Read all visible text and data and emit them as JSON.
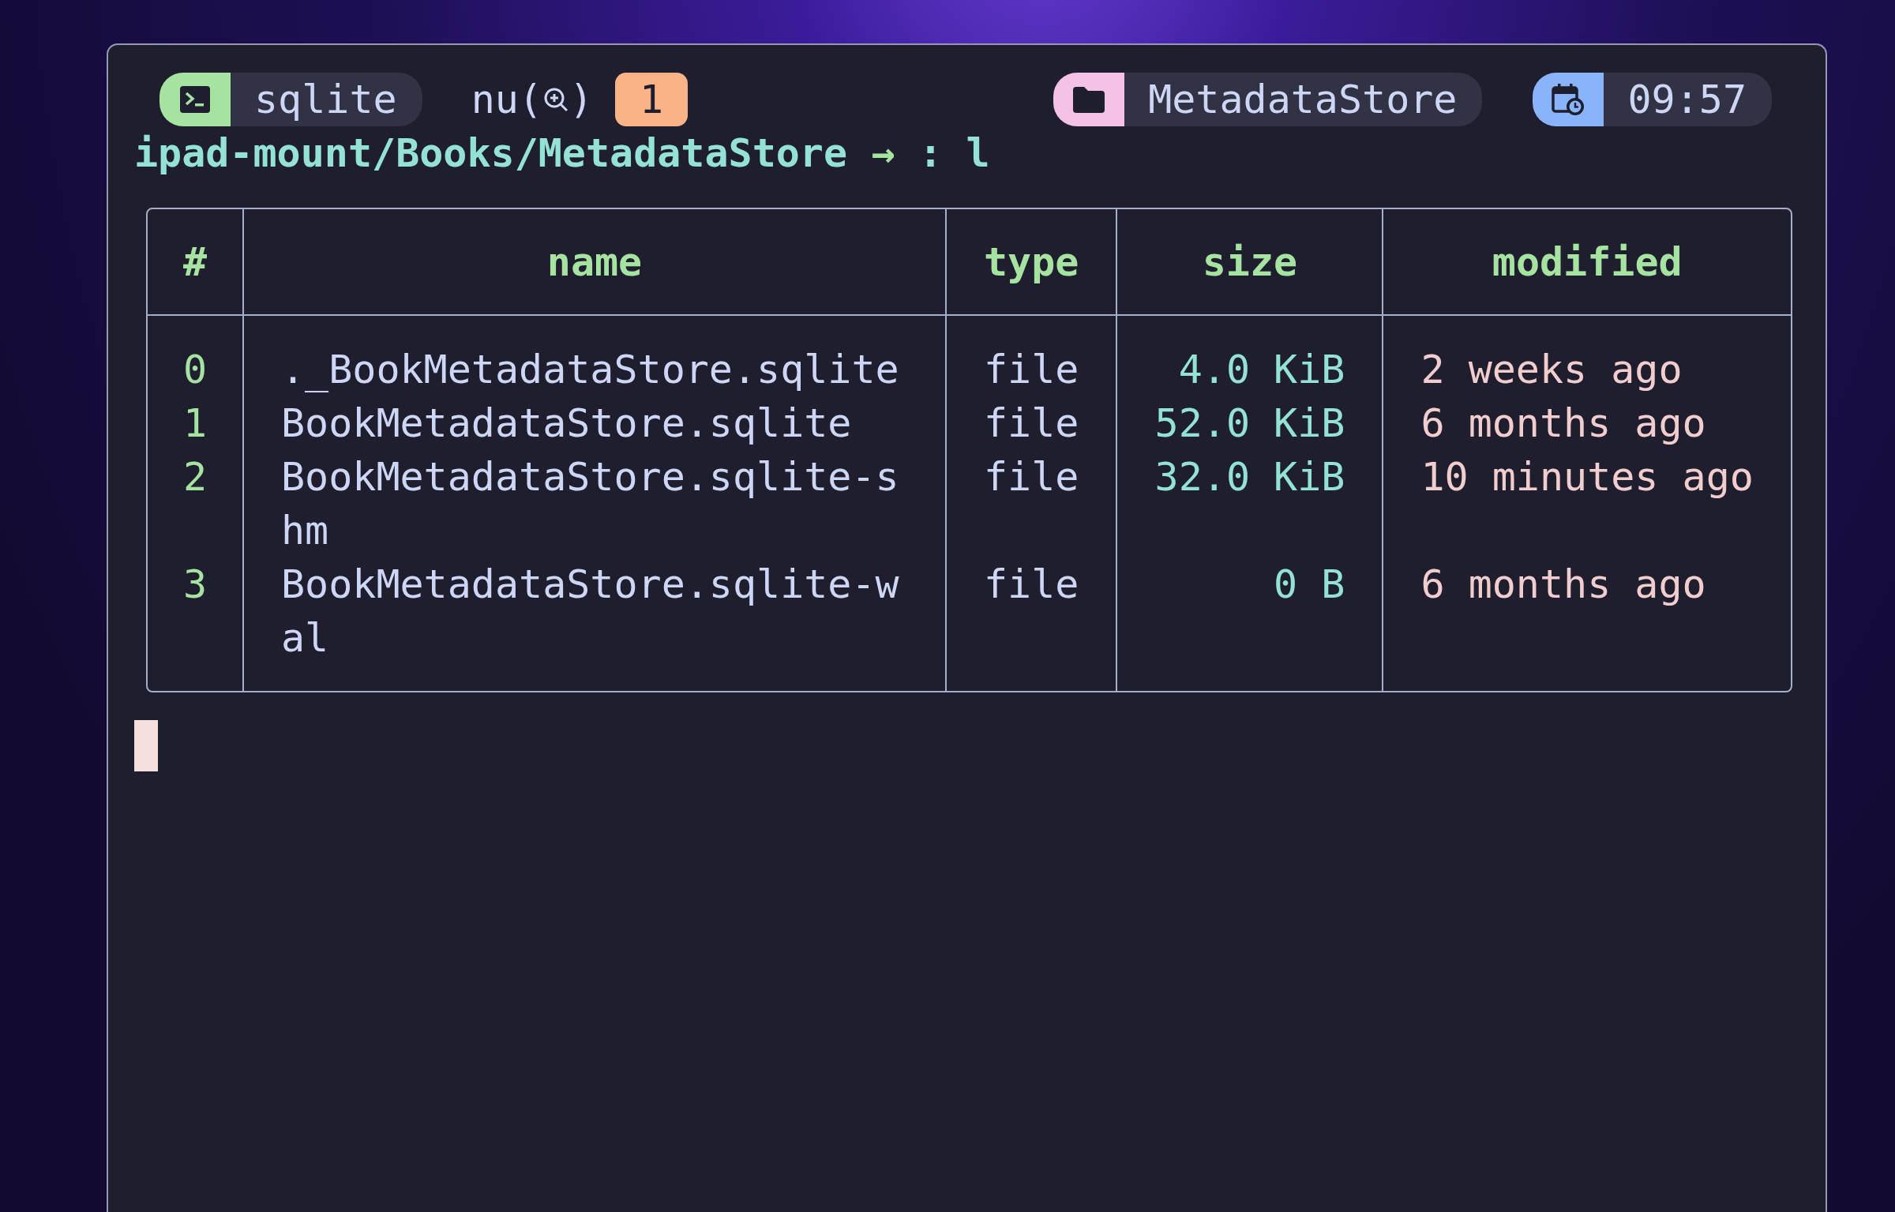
{
  "status_bar": {
    "left": [
      {
        "kind": "terminal",
        "color": "#a6e3a1",
        "label": "sqlite"
      }
    ],
    "shell": {
      "prefix": "nu(",
      "suffix": ")"
    },
    "badge": "1",
    "right": [
      {
        "kind": "folder",
        "color": "#f5c2e7",
        "label": "MetadataStore"
      },
      {
        "kind": "calendar-clock",
        "color": "#89b4fa",
        "label": "09:57"
      }
    ]
  },
  "prompt": {
    "path": "ipad-mount/Books/MetadataStore",
    "arrow": "→",
    "command": ": l"
  },
  "table": {
    "columns": [
      "#",
      "name",
      "type",
      "size",
      "modified"
    ],
    "rows": [
      {
        "index": "0",
        "name": "._BookMetadataStore.sqlite",
        "type": "file",
        "size": "4.0 KiB",
        "modified": "2 weeks ago"
      },
      {
        "index": "1",
        "name": "BookMetadataStore.sqlite",
        "type": "file",
        "size": "52.0 KiB",
        "modified": "6 months ago"
      },
      {
        "index": "2",
        "name": "BookMetadataStore.sqlite-shm",
        "type": "file",
        "size": "32.0 KiB",
        "modified": "10 minutes ago"
      },
      {
        "index": "3",
        "name": "BookMetadataStore.sqlite-wal",
        "type": "file",
        "size": "0 B",
        "modified": "6 months ago"
      }
    ]
  }
}
